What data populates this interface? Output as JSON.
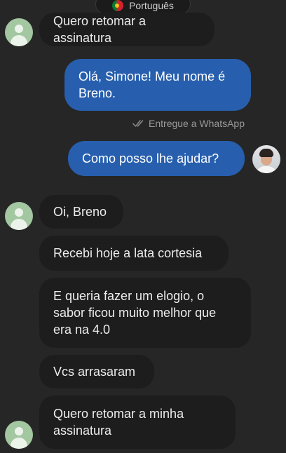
{
  "language_pill": {
    "label": "Português",
    "flag_icon": "portugal-flag-icon"
  },
  "colors": {
    "background": "#262626",
    "incoming_bubble": "#1d1d1d",
    "outgoing_bubble": "#275fae",
    "status_text": "#9a9a9a"
  },
  "messages": [
    {
      "direction": "incoming",
      "text": "Quero retomar a assinatura"
    },
    {
      "direction": "outgoing",
      "text": "Olá, Simone! Meu nome é\nBreno."
    },
    {
      "direction": "outgoing",
      "text": "Como posso lhe ajudar?"
    },
    {
      "direction": "incoming",
      "text": "Oi, Breno"
    },
    {
      "direction": "incoming",
      "text": "Recebi hoje a lata cortesia"
    },
    {
      "direction": "incoming",
      "text": "E queria fazer um elogio, o\nsabor ficou muito melhor que\nera na 4.0"
    },
    {
      "direction": "incoming",
      "text": "Vcs arrasaram"
    },
    {
      "direction": "incoming",
      "text": "Quero retomar a minha\nassinatura"
    }
  ],
  "delivery_status": {
    "icon": "double-check-icon",
    "text": "Entregue a WhatsApp"
  }
}
